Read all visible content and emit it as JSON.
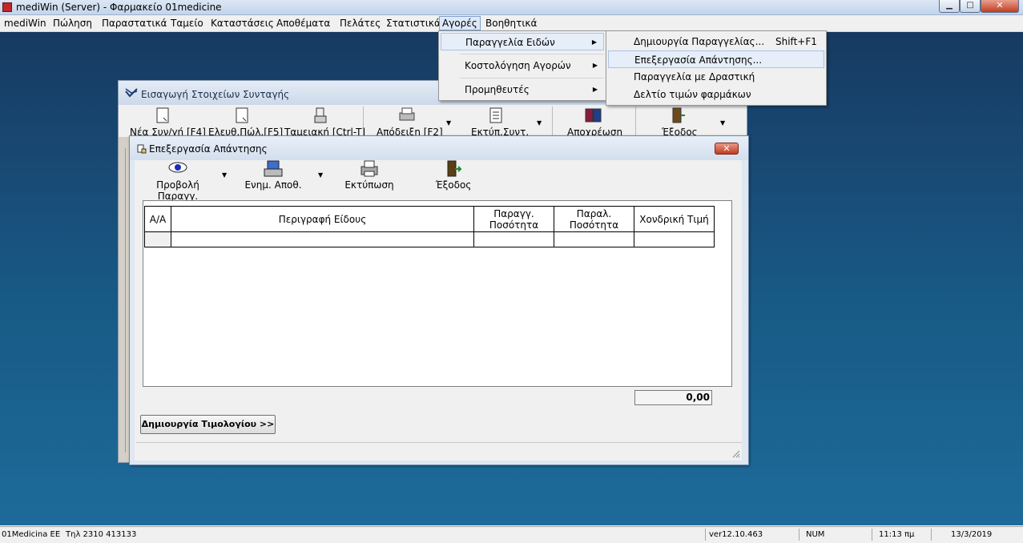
{
  "window": {
    "title": "mediWin (Server) - Φαρμακείο 01medicine",
    "min_glyph": "▁",
    "max_glyph": "□",
    "close_glyph": "✕"
  },
  "menubar": [
    {
      "label": "mediWin"
    },
    {
      "label": "Πώληση"
    },
    {
      "label": "Παραστατικά"
    },
    {
      "label": "Ταμείο"
    },
    {
      "label": "Καταστάσεις"
    },
    {
      "label": "Αποθέματα"
    },
    {
      "label": "Πελάτες"
    },
    {
      "label": "Στατιστικά"
    },
    {
      "label": "Αγορές",
      "active": true
    },
    {
      "label": "Βοηθητικά"
    }
  ],
  "agores_menu": [
    {
      "label": "Παραγγελία Ειδών",
      "submenu": true
    },
    {
      "label": "Κοστολόγηση Αγορών",
      "submenu": true
    },
    {
      "label": "Προμηθευτές",
      "submenu": true
    }
  ],
  "submenu": [
    {
      "label": "Δημιουργία Παραγγελίας...",
      "shortcut": "Shift+F1"
    },
    {
      "label": "Επεξεργασία Απάντησης...",
      "highlighted": true
    },
    {
      "label": "Παραγγελία με Δραστική"
    },
    {
      "label": "Δελτίο τιμών φαρμάκων"
    }
  ],
  "backwin": {
    "title": "Εισαγωγή Στοιχείων Συνταγής",
    "toolbar": [
      {
        "label": "Νέα Συν/γή [F4]"
      },
      {
        "label": "Ελευθ.Πώλ.[F5]"
      },
      {
        "label": "Ταμειακή [Ctrl-T]"
      },
      {
        "label": "Απόδειξη [F2]"
      },
      {
        "label": "Εκτύπ.Συντ."
      },
      {
        "label": "Αποχρέωση"
      },
      {
        "label": "Έξοδος"
      }
    ]
  },
  "dialog": {
    "title": "Επεξεργασία Απάντησης",
    "close_glyph": "✕",
    "toolbar": [
      {
        "label": "Προβολή Παραγγ."
      },
      {
        "label": "Ενημ. Αποθ."
      },
      {
        "label": "Εκτύπωση"
      },
      {
        "label": "Έξοδος"
      }
    ],
    "grid": {
      "columns": [
        "Α/Α",
        "Περιγραφή Είδους",
        "Παραγγ. Ποσότητα",
        "Παραλ. Ποσότητα",
        "Χονδρική Τιμή"
      ]
    },
    "total": "0,00",
    "create_invoice_button": "Δημιουργία Τιμολογίου >>"
  },
  "statusbar": {
    "company": "01Medicina ΕΕ",
    "phone": "Τηλ 2310 413133",
    "version": "ver12.10.463",
    "num": "NUM",
    "time": "11:13 πμ",
    "date": "13/3/2019"
  }
}
